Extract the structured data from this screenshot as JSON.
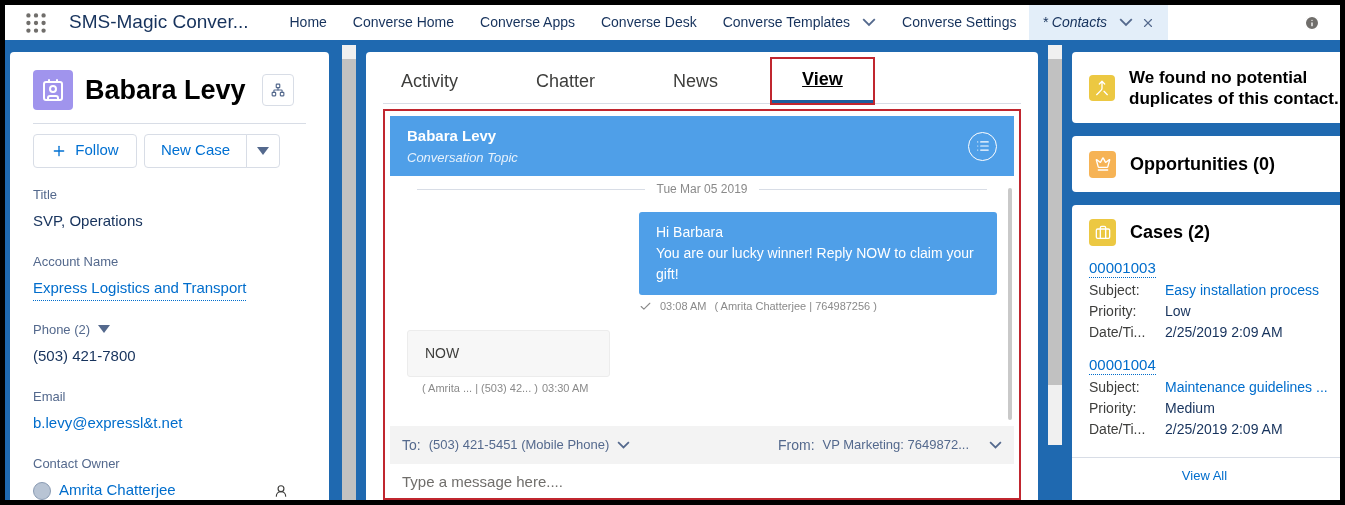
{
  "nav": {
    "app_name": "SMS-Magic Conver...",
    "items": [
      {
        "label": "Home",
        "selected": false,
        "dropdown": false,
        "closable": false
      },
      {
        "label": "Converse Home",
        "selected": false,
        "dropdown": false,
        "closable": false
      },
      {
        "label": "Converse Apps",
        "selected": false,
        "dropdown": false,
        "closable": false
      },
      {
        "label": "Converse Desk",
        "selected": false,
        "dropdown": false,
        "closable": false
      },
      {
        "label": "Converse Templates",
        "selected": false,
        "dropdown": true,
        "closable": false
      },
      {
        "label": "Converse Settings",
        "selected": false,
        "dropdown": false,
        "closable": false
      },
      {
        "label": "* Contacts",
        "selected": true,
        "dropdown": true,
        "closable": true
      }
    ]
  },
  "record": {
    "name": "Babara Levy",
    "follow": "Follow",
    "new_case": "New Case",
    "fields": [
      {
        "kind": "text",
        "label": "Title",
        "value": "SVP, Operations"
      },
      {
        "kind": "link",
        "label": "Account Name",
        "value": "Express Logistics and Transport"
      },
      {
        "kind": "phone",
        "label": "Phone (2)",
        "value": "(503) 421-7800"
      },
      {
        "kind": "email",
        "label": "Email",
        "value": "b.levy@expressl&t.net"
      },
      {
        "kind": "owner",
        "label": "Contact Owner",
        "value": "Amrita Chatterjee"
      }
    ]
  },
  "tabs": [
    {
      "label": "Activity",
      "selected": false
    },
    {
      "label": "Chatter",
      "selected": false
    },
    {
      "label": "News",
      "selected": false
    },
    {
      "label": "View",
      "selected": true
    }
  ],
  "conversation": {
    "contact": "Babara Levy",
    "topic": "Conversation Topic",
    "date": "Tue Mar 05 2019",
    "messages": [
      {
        "kind": "outgoing",
        "lines": [
          "Hi Barbara",
          "You are our lucky winner! Reply NOW to claim your gift!"
        ],
        "time": "03:08 AM",
        "detail": "( Amrita Chatterjee |  764987256 )"
      },
      {
        "kind": "incoming",
        "lines": [
          "NOW"
        ],
        "time": "03:30 AM",
        "detail": "( Amrita ... |   (503) 42... )"
      }
    ],
    "to_label": "To:",
    "to": "(503) 421-5451 (Mobile Phone)",
    "from_label": "From:",
    "from": "VP Marketing: 7649872...",
    "placeholder": "Type a message here...."
  },
  "duplicates": "We found no potential duplicates of this contact.",
  "opportunities": {
    "title": "Opportunities (0)"
  },
  "cases": {
    "title": "Cases (2)",
    "view_all": "View All",
    "items": [
      {
        "number": "00001003",
        "fields": [
          {
            "label": "Subject:",
            "value": "Easy installation process",
            "kind": "link"
          },
          {
            "label": "Priority:",
            "value": "Low",
            "kind": "text"
          },
          {
            "label": "Date/Ti...",
            "value": "2/25/2019 2:09 AM",
            "kind": "text"
          }
        ]
      },
      {
        "number": "00001004",
        "fields": [
          {
            "label": "Subject:",
            "value": "Maintenance guidelines ...",
            "kind": "link"
          },
          {
            "label": "Priority:",
            "value": "Medium",
            "kind": "text"
          },
          {
            "label": "Date/Ti...",
            "value": "2/25/2019 2:09 AM",
            "kind": "text"
          }
        ]
      }
    ]
  }
}
